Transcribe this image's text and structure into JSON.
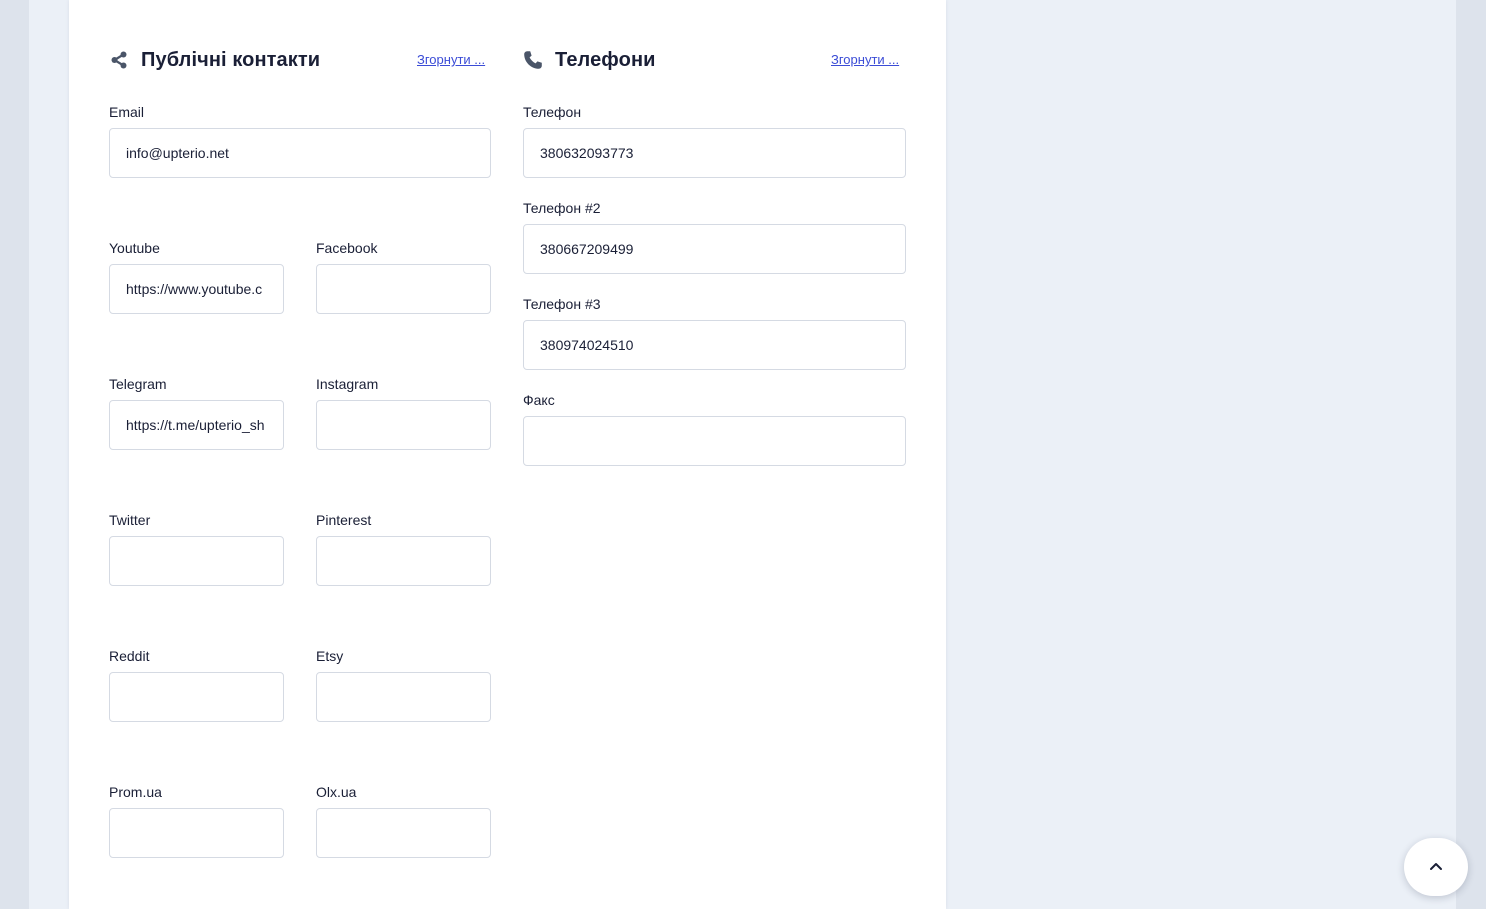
{
  "public_contacts": {
    "title": "Публічні контакти",
    "icon": "share-icon",
    "collapse_label": "Згорнути ...",
    "email": {
      "label": "Email",
      "value": "info@upterio.net"
    },
    "youtube": {
      "label": "Youtube",
      "value": "https://www.youtube.c"
    },
    "facebook": {
      "label": "Facebook",
      "value": ""
    },
    "telegram": {
      "label": "Telegram",
      "value": "https://t.me/upterio_sh"
    },
    "instagram": {
      "label": "Instagram",
      "value": ""
    },
    "twitter": {
      "label": "Twitter",
      "value": ""
    },
    "pinterest": {
      "label": "Pinterest",
      "value": ""
    },
    "reddit": {
      "label": "Reddit",
      "value": ""
    },
    "etsy": {
      "label": "Etsy",
      "value": ""
    },
    "prom": {
      "label": "Prom.ua",
      "value": ""
    },
    "olx": {
      "label": "Olx.ua",
      "value": ""
    }
  },
  "phones": {
    "title": "Телефони",
    "icon": "phone-icon",
    "collapse_label": "Згорнути ...",
    "phone1": {
      "label": "Телефон",
      "value": "380632093773"
    },
    "phone2": {
      "label": "Телефон #2",
      "value": "380667209499"
    },
    "phone3": {
      "label": "Телефон #3",
      "value": "380974024510"
    },
    "fax": {
      "label": "Факс",
      "value": ""
    }
  },
  "scroll_top_icon": "chevron-up-icon",
  "colors": {
    "accent_link": "#3b4cd6",
    "icon": "#4a5568",
    "page_bg": "#ebf0f7"
  }
}
